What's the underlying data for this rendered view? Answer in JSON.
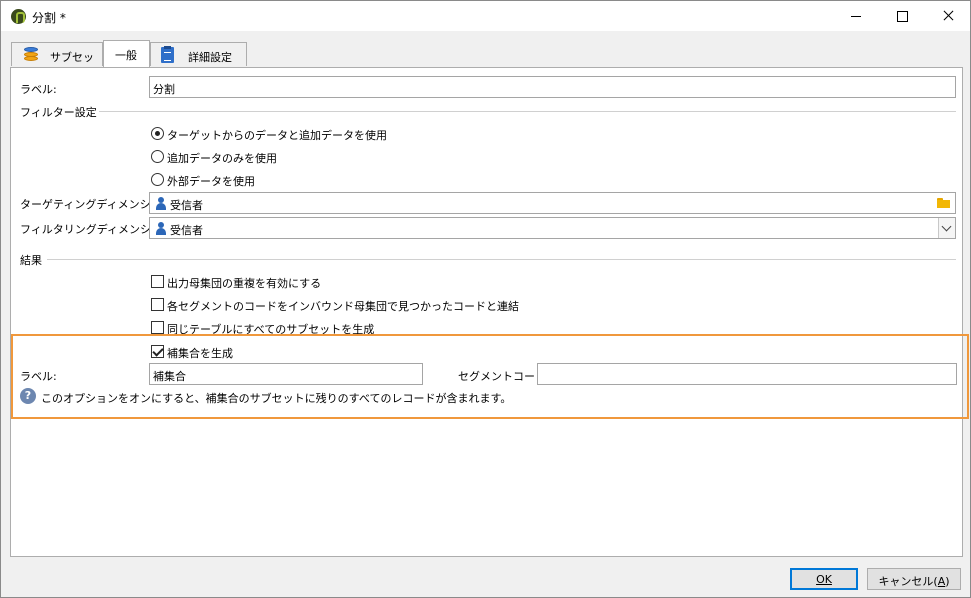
{
  "window": {
    "title": "分割 *"
  },
  "tabs": [
    {
      "label": "サブセット",
      "icon": "database-icon"
    },
    {
      "label": "一般"
    },
    {
      "label": "詳細設定",
      "icon": "clipboard-icon"
    }
  ],
  "general": {
    "label_caption": "ラベル:",
    "label_value": "分割",
    "filter_group": "フィルター設定",
    "radio_options": [
      {
        "label": "ターゲットからのデータと追加データを使用",
        "checked": true
      },
      {
        "label": "追加データのみを使用",
        "checked": false
      },
      {
        "label": "外部データを使用",
        "checked": false
      }
    ],
    "targeting_caption": "ターゲティングディメンション:",
    "targeting_value": "受信者",
    "filtering_caption": "フィルタリングディメンション:",
    "filtering_value": "受信者",
    "results_group": "結果",
    "checkboxes": [
      {
        "label": "出力母集団の重複を有効にする",
        "checked": false
      },
      {
        "label": "各セグメントのコードをインバウンド母集団で見つかったコードと連結",
        "checked": false
      },
      {
        "label": "同じテーブルにすべてのサブセットを生成",
        "checked": false
      },
      {
        "label": "補集合を生成",
        "checked": true
      }
    ],
    "complement_label_caption": "ラベル:",
    "complement_label_value": "補集合",
    "segment_code_caption": "セグメントコード:",
    "segment_code_value": "",
    "help_text": "このオプションをオンにすると、補集合のサブセットに残りのすべてのレコードが含まれます。"
  },
  "buttons": {
    "ok": "OK",
    "cancel_prefix": "キャンセル(",
    "cancel_key": "A",
    "cancel_suffix": ")"
  },
  "colors": {
    "highlight": "#f0983c",
    "accent": "#0078d7"
  }
}
